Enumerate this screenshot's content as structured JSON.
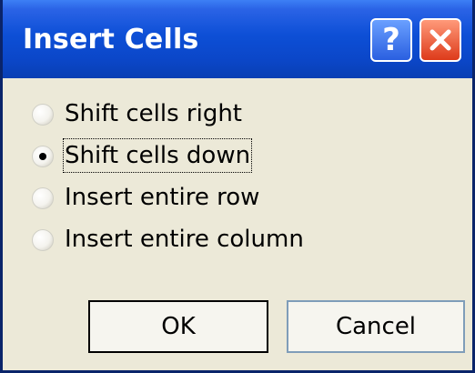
{
  "dialog": {
    "title": "Insert Cells",
    "help_glyph": "?",
    "options": [
      {
        "label": "Shift cells right",
        "checked": false
      },
      {
        "label": "Shift cells down",
        "checked": true
      },
      {
        "label": "Insert entire row",
        "checked": false
      },
      {
        "label": "Insert entire column",
        "checked": false
      }
    ],
    "ok_label": "OK",
    "cancel_label": "Cancel",
    "colors": {
      "titlebar": "#0b47c9",
      "face": "#ece9d8",
      "close": "#dd3a1a"
    }
  }
}
